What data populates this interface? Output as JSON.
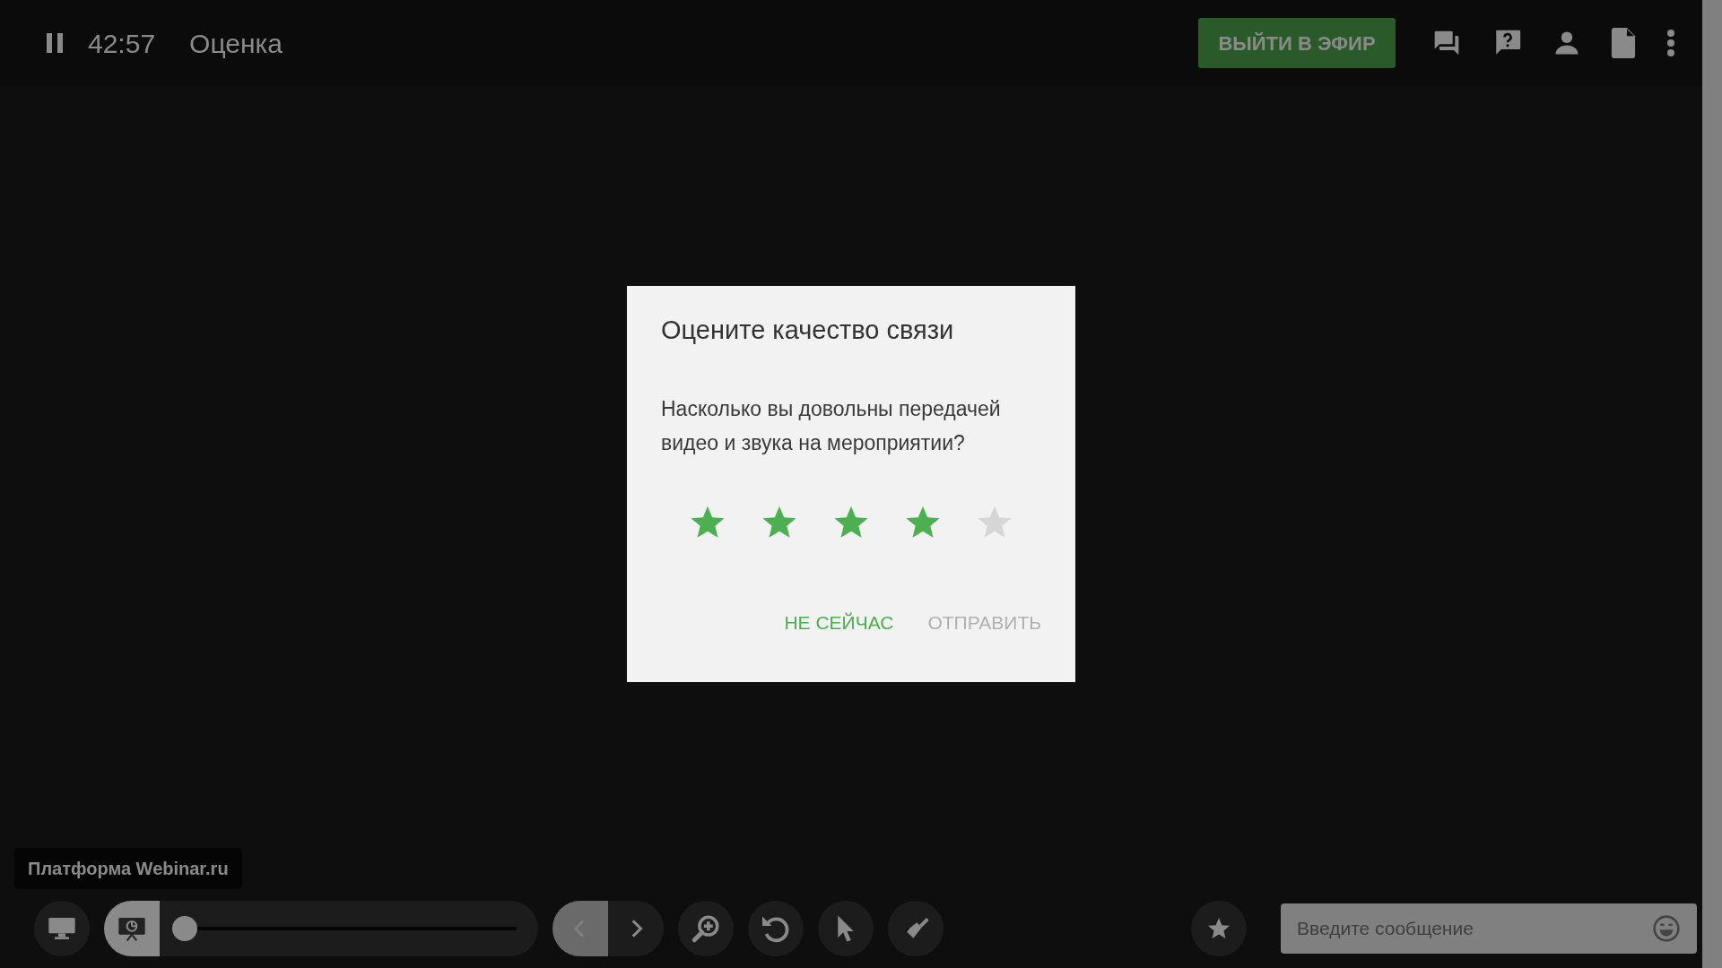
{
  "top_bar": {
    "time": "42:57",
    "title": "Оценка",
    "go_live_button": "ВЫЙТИ В ЭФИР"
  },
  "dialog": {
    "title": "Оцените качество связи",
    "question": "Насколько вы довольны передачей видео и звука на мероприятии?",
    "stars": 4,
    "buttons": [
      {
        "label": "НЕ СЕЙЧАС",
        "disabled": false
      },
      {
        "label": "ОТПРАВИТЬ",
        "disabled": true
      }
    ]
  },
  "watermark_label": "Платформа Webinar.ru",
  "view_modes": [
    {
      "kind": "screen",
      "selected": false
    },
    {
      "kind": "presentation",
      "selected": true
    }
  ],
  "slide_slider": {
    "level": 0
  },
  "nav": [
    {
      "kind": "prev",
      "disabled": true
    },
    {
      "kind": "next",
      "disabled": false
    }
  ],
  "message_field": {
    "placeholder": "Введите сообщение"
  }
}
